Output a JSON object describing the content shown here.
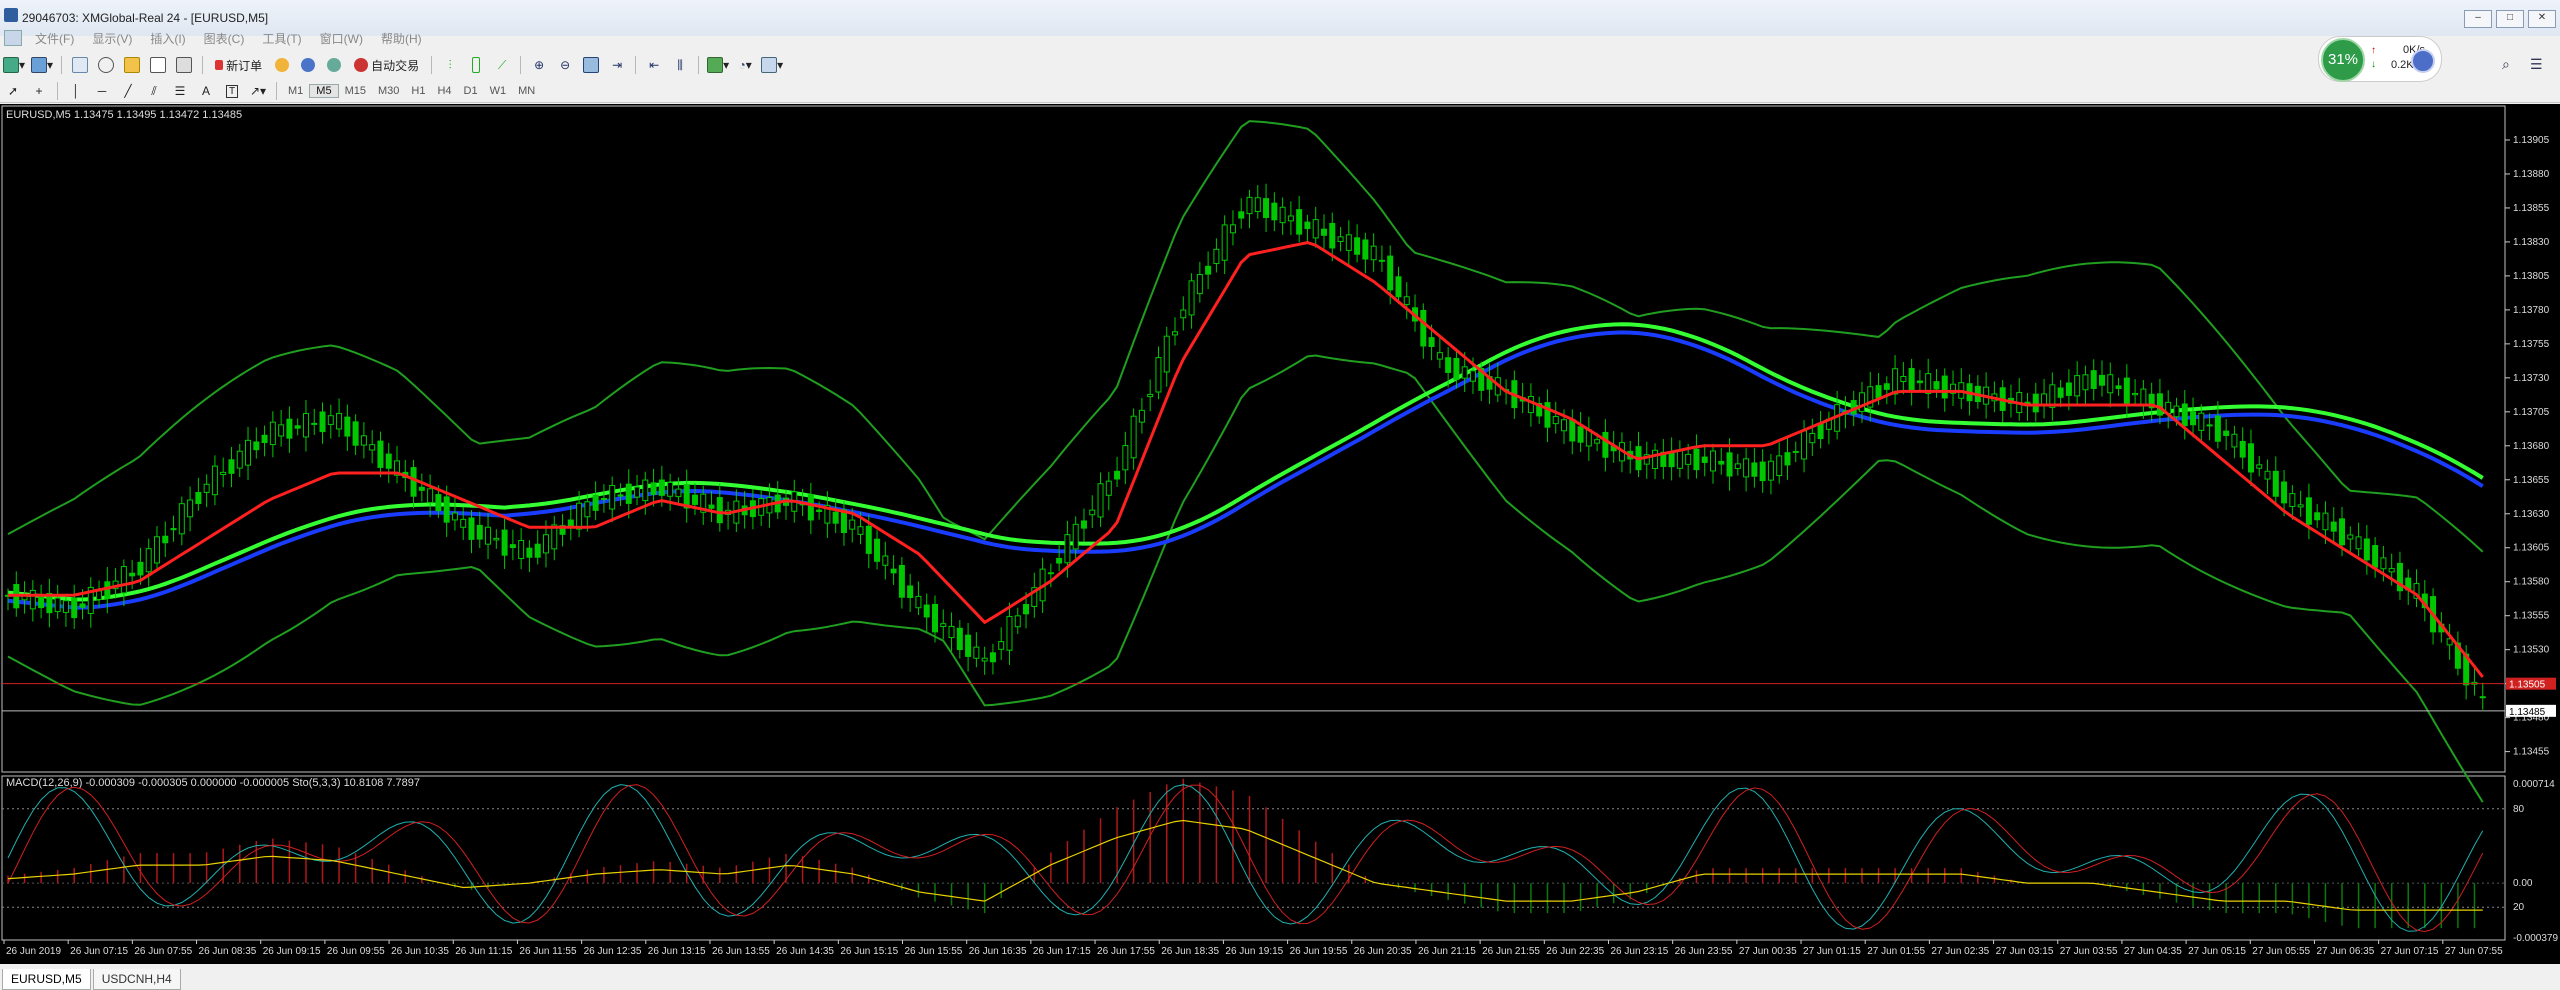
{
  "window": {
    "title": "29046703: XMGlobal-Real 24 - [EURUSD,M5]",
    "buttons": [
      "▭",
      "▭",
      "✕"
    ]
  },
  "menu": [
    "文件(F)",
    "显示(V)",
    "插入(I)",
    "图表(C)",
    "工具(T)",
    "窗口(W)",
    "帮助(H)"
  ],
  "toolbar": {
    "new_order": "新订单",
    "auto_trading": "自动交易"
  },
  "timeframes": [
    "M1",
    "M5",
    "M15",
    "M30",
    "H1",
    "H4",
    "D1",
    "W1",
    "MN"
  ],
  "active_timeframe": "M5",
  "network": {
    "percent": "31%",
    "up": "0K/s",
    "down": "0.2K/s"
  },
  "chart": {
    "header": "EURUSD,M5  1.13475 1.13495 1.13472 1.13485",
    "price_ticks": [
      "1.13905",
      "1.13880",
      "1.13855",
      "1.13830",
      "1.13805",
      "1.13780",
      "1.13755",
      "1.13730",
      "1.13705",
      "1.13680",
      "1.13655",
      "1.13630",
      "1.13605",
      "1.13580",
      "1.13555",
      "1.13530",
      "1.13505",
      "1.13480",
      "1.13455"
    ],
    "current_price": "1.13485",
    "red_line_price": "1.13505",
    "indicator_header": "MACD(12,26,9) -0.000309 -0.000305 0.000000 -0.000005  Sto(5,3,3) 10.8108 7.7897",
    "indicator_ticks": [
      "0.000714",
      "80",
      "0.00",
      "20",
      "-0.000379"
    ],
    "time_labels": [
      "26 Jun 2019",
      "26 Jun 07:15",
      "26 Jun 07:55",
      "26 Jun 08:35",
      "26 Jun 09:15",
      "26 Jun 09:55",
      "26 Jun 10:35",
      "26 Jun 11:15",
      "26 Jun 11:55",
      "26 Jun 12:35",
      "26 Jun 13:15",
      "26 Jun 13:55",
      "26 Jun 14:35",
      "26 Jun 15:15",
      "26 Jun 15:55",
      "26 Jun 16:35",
      "26 Jun 17:15",
      "26 Jun 17:55",
      "26 Jun 18:35",
      "26 Jun 19:15",
      "26 Jun 19:55",
      "26 Jun 20:35",
      "26 Jun 21:15",
      "26 Jun 21:55",
      "26 Jun 22:35",
      "26 Jun 23:15",
      "26 Jun 23:55",
      "27 Jun 00:35",
      "27 Jun 01:15",
      "27 Jun 01:55",
      "27 Jun 02:35",
      "27 Jun 03:15",
      "27 Jun 03:55",
      "27 Jun 04:35",
      "27 Jun 05:15",
      "27 Jun 05:55",
      "27 Jun 06:35",
      "27 Jun 07:15",
      "27 Jun 07:55"
    ]
  },
  "chart_data": {
    "type": "line",
    "title": "EURUSD,M5",
    "ylim": [
      1.1344,
      1.1393
    ],
    "series": [
      {
        "name": "EURUSD close",
        "values": [
          1.1357,
          1.1356,
          1.1359,
          1.1365,
          1.1369,
          1.137,
          1.1366,
          1.1362,
          1.136,
          1.1364,
          1.1365,
          1.1363,
          1.1364,
          1.1362,
          1.1356,
          1.1352,
          1.1359,
          1.1366,
          1.1378,
          1.1386,
          1.1384,
          1.1382,
          1.1374,
          1.1372,
          1.1369,
          1.1367,
          1.1367,
          1.1366,
          1.137,
          1.1373,
          1.1372,
          1.1371,
          1.1373,
          1.1371,
          1.1369,
          1.1364,
          1.1361,
          1.1357,
          1.1349
        ]
      },
      {
        "name": "moving average (red)",
        "values": [
          1.1357,
          1.1357,
          1.1358,
          1.1361,
          1.1364,
          1.1366,
          1.1366,
          1.1364,
          1.1362,
          1.1362,
          1.1364,
          1.1363,
          1.1364,
          1.1363,
          1.136,
          1.1355,
          1.1358,
          1.1362,
          1.1374,
          1.1382,
          1.1383,
          1.138,
          1.1376,
          1.1372,
          1.137,
          1.1367,
          1.1368,
          1.1368,
          1.137,
          1.1372,
          1.1372,
          1.1371,
          1.1371,
          1.1371,
          1.1367,
          1.1363,
          1.136,
          1.1357,
          1.1351
        ]
      }
    ],
    "macd": {
      "values": [
        5e-05,
        0.0001,
        0.0002,
        0.0002,
        0.0003,
        0.00025,
        0.0001,
        -5e-05,
        0.0,
        0.0001,
        0.00015,
        0.0001,
        0.0002,
        0.0001,
        -0.0001,
        -0.0002,
        0.0002,
        0.0005,
        0.0007,
        0.0006,
        0.0003,
        0.0,
        -0.0001,
        -0.0002,
        -0.0002,
        -0.0001,
        0.0001,
        0.0001,
        0.0001,
        0.0001,
        0.0001,
        0.0,
        0.0,
        -0.0001,
        -0.0002,
        -0.0002,
        -0.0003,
        -0.0003,
        -0.0003
      ]
    },
    "stochastic": {
      "main": 10.8108,
      "signal": 7.7897,
      "levels": [
        80,
        20
      ]
    }
  },
  "tabs": [
    {
      "label": "EURUSD,M5",
      "active": true
    },
    {
      "label": "USDCNH,H4",
      "active": false
    }
  ],
  "colors": {
    "chart_bg": "#000000",
    "bull_candle": "#00c800",
    "ma_red": "#ff2020",
    "ma_blue": "#1a3cff",
    "ma_green": "#33ff33",
    "bands": "#1f9e1f"
  }
}
